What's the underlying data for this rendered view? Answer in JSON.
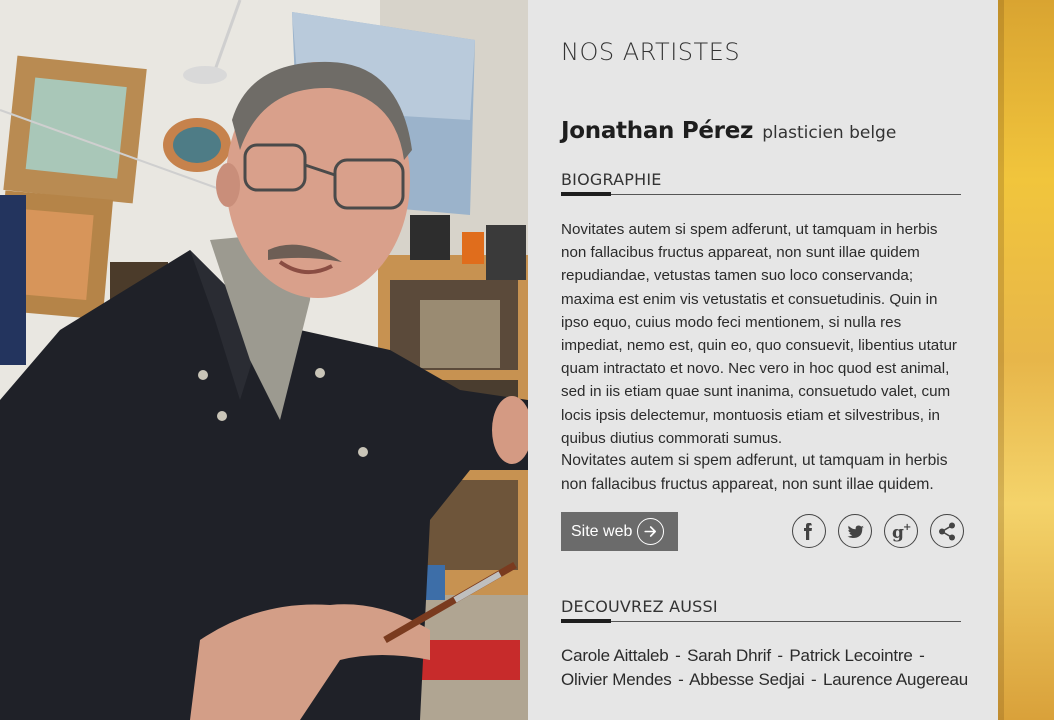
{
  "panel": {
    "section_title": "NOS ARTISTES",
    "artist_name": "Jonathan Pérez",
    "artist_role": "plasticien belge",
    "bio_heading": "BIOGRAPHIE",
    "bio_paragraph_1": "Novitates autem si spem adferunt, ut tamquam in herbis non fallacibus fructus appareat, non sunt illae quidem repudiandae, vetustas tamen suo loco conservanda; maxima est enim vis vetustatis et consuetudinis. Quin in ipso equo, cuius modo feci mentionem, si nulla res impediat, nemo est, quin eo, quo consuevit, libentius utatur quam intractato et novo. Nec vero in hoc quod est animal, sed in iis etiam quae sunt inanima, consuetudo valet, cum locis ipsis delectemur, montuosis etiam et silvestribus, in quibus diutius commorati sumus.",
    "bio_paragraph_2": "Novitates autem si spem adferunt, ut tamquam in herbis non fallacibus fructus appareat, non sunt illae quidem.",
    "site_button_label": "Site web",
    "social_icons": [
      "facebook-icon",
      "twitter-icon",
      "google-plus-icon",
      "share-icon"
    ],
    "discover_heading": "DECOUVREZ AUSSI",
    "discover_separator": "-",
    "discover_artists": [
      "Carole Aittaleb",
      "Sarah Dhrif",
      "Patrick Lecointre",
      "Olivier Mendes",
      "Abbesse Sedjai",
      "Laurence Augereau"
    ]
  },
  "colors": {
    "panel_bg": "#e6e6e6",
    "button_bg": "#6b6b6b",
    "text": "#2b2b2b",
    "accent_rule": "#1e1e1e",
    "art_yellow": "#f1c53c"
  }
}
